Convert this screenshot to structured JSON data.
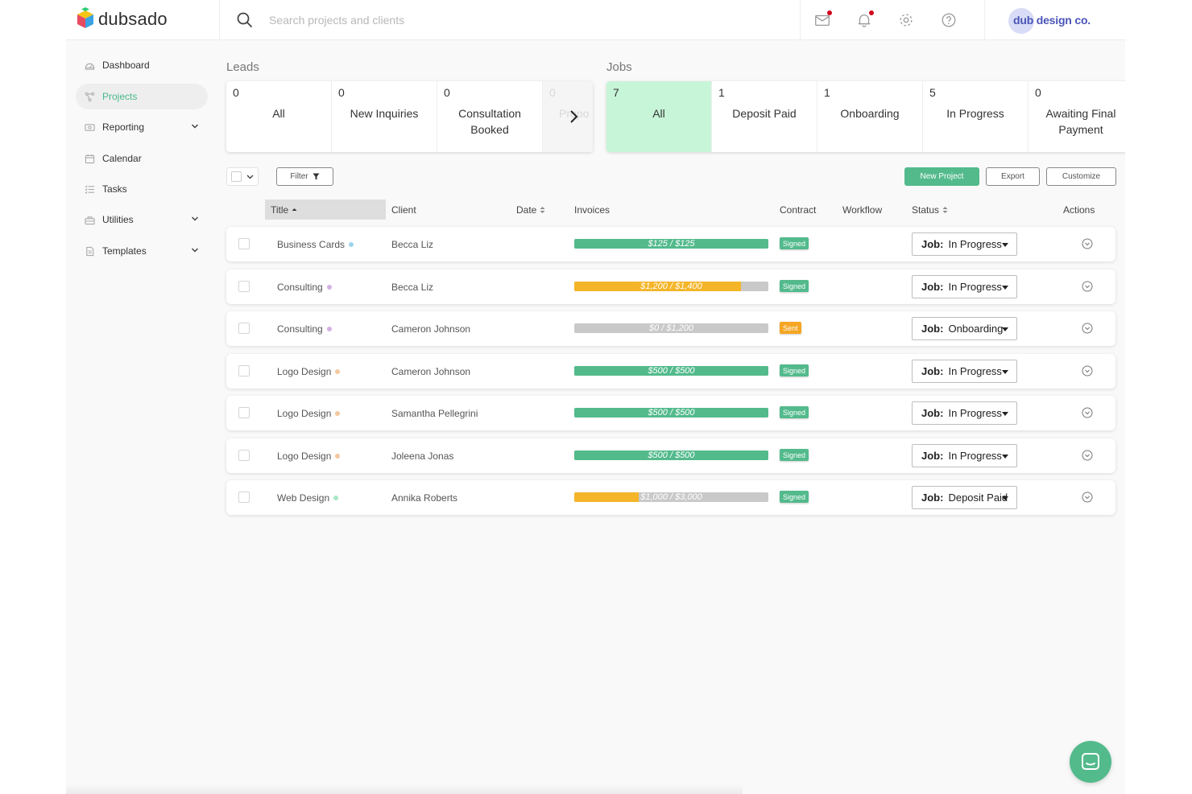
{
  "app": {
    "logo_text": "dubsado",
    "brand_text": "dub design co."
  },
  "search": {
    "placeholder": "Search projects and clients"
  },
  "header_icons": [
    "mail-icon",
    "bell-icon",
    "gear-icon",
    "help-icon"
  ],
  "sidebar": {
    "items": [
      {
        "label": "Dashboard",
        "icon": "dashboard-icon"
      },
      {
        "label": "Projects",
        "icon": "projects-icon",
        "active": true
      },
      {
        "label": "Reporting",
        "icon": "reporting-icon",
        "expandable": true
      },
      {
        "label": "Calendar",
        "icon": "calendar-icon"
      },
      {
        "label": "Tasks",
        "icon": "tasks-icon"
      },
      {
        "label": "Utilities",
        "icon": "utilities-icon",
        "expandable": true
      },
      {
        "label": "Templates",
        "icon": "templates-icon",
        "expandable": true
      }
    ]
  },
  "leads": {
    "label": "Leads",
    "cards": [
      {
        "count": "0",
        "label": "All"
      },
      {
        "count": "0",
        "label": "New Inquiries"
      },
      {
        "count": "0",
        "label": "Consultation Booked"
      },
      {
        "count": "0",
        "label": "Propo"
      }
    ]
  },
  "jobs": {
    "label": "Jobs",
    "cards": [
      {
        "count": "7",
        "label": "All"
      },
      {
        "count": "1",
        "label": "Deposit Paid"
      },
      {
        "count": "1",
        "label": "Onboarding"
      },
      {
        "count": "5",
        "label": "In Progress"
      },
      {
        "count": "0",
        "label": "Awaiting Final Payment"
      }
    ]
  },
  "toolbar": {
    "filter_label": "Filter",
    "new_project_label": "New Project",
    "export_label": "Export",
    "customize_label": "Customize"
  },
  "table": {
    "headers": {
      "title": "Title",
      "client": "Client",
      "date": "Date",
      "invoices": "Invoices",
      "contract": "Contract",
      "workflow": "Workflow",
      "status": "Status",
      "actions": "Actions"
    },
    "rows": [
      {
        "title": "Business Cards",
        "dot_color": "#9ed3ec",
        "client": "Becca Liz",
        "invoice_text": "$125 / $125",
        "paid_fraction": 1.0,
        "bar_color": "#53ba8c",
        "contract": "Signed",
        "contract_color": "#53ba8c",
        "status_prefix": "Job:",
        "status": "In Progress"
      },
      {
        "title": "Consulting",
        "dot_color": "#d3b1e4",
        "client": "Becca Liz",
        "invoice_text": "$1,200 / $1,400",
        "paid_fraction": 0.857,
        "bar_color": "#f5b529",
        "contract": "Signed",
        "contract_color": "#53ba8c",
        "status_prefix": "Job:",
        "status": "In Progress"
      },
      {
        "title": "Consulting",
        "dot_color": "#d3b1e4",
        "client": "Cameron Johnson",
        "invoice_text": "$0 / $1,200",
        "paid_fraction": 0.0,
        "bar_color": "#f5b529",
        "contract": "Sent",
        "contract_color": "#f5a623",
        "status_prefix": "Job:",
        "status": "Onboarding"
      },
      {
        "title": "Logo Design",
        "dot_color": "#f4c7a0",
        "client": "Cameron Johnson",
        "invoice_text": "$500 / $500",
        "paid_fraction": 1.0,
        "bar_color": "#53ba8c",
        "contract": "Signed",
        "contract_color": "#53ba8c",
        "status_prefix": "Job:",
        "status": "In Progress"
      },
      {
        "title": "Logo Design",
        "dot_color": "#f4c7a0",
        "client": "Samantha Pellegrini",
        "invoice_text": "$500 / $500",
        "paid_fraction": 1.0,
        "bar_color": "#53ba8c",
        "contract": "Signed",
        "contract_color": "#53ba8c",
        "status_prefix": "Job:",
        "status": "In Progress"
      },
      {
        "title": "Logo Design",
        "dot_color": "#f4c7a0",
        "client": "Joleena Jonas",
        "invoice_text": "$500 / $500",
        "paid_fraction": 1.0,
        "bar_color": "#53ba8c",
        "contract": "Signed",
        "contract_color": "#53ba8c",
        "status_prefix": "Job:",
        "status": "In Progress"
      },
      {
        "title": "Web Design",
        "dot_color": "#a6e8c8",
        "client": "Annika Roberts",
        "invoice_text": "$1,000 / $3,000",
        "paid_fraction": 0.333,
        "bar_color": "#f5b529",
        "contract": "Signed",
        "contract_color": "#53ba8c",
        "status_prefix": "Job:",
        "status": "Deposit Paid"
      }
    ]
  },
  "colors": {
    "accent": "#53ba8c",
    "selected_card": "#c7f5d8",
    "warning": "#f5b529",
    "notification": "#d0021b",
    "brand": "#4a55b8"
  }
}
